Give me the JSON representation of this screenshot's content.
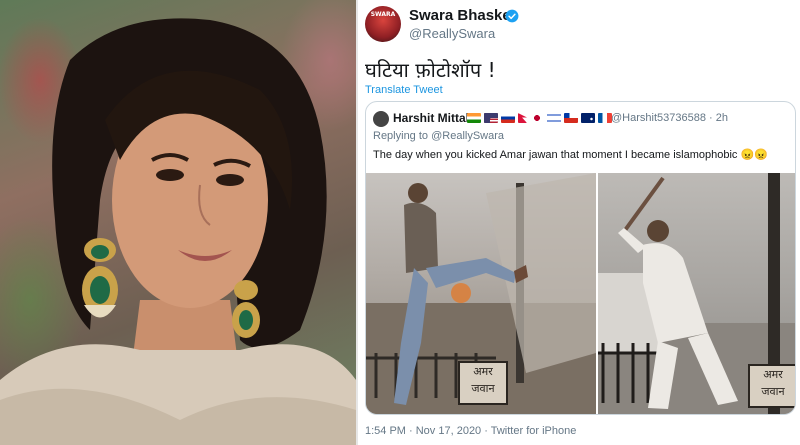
{
  "tweet": {
    "display_name": "Swara Bhasker",
    "handle": "@ReallySwara",
    "text": "घटिया फ़ोटोशॉप !",
    "translate_label": "Translate Tweet",
    "avatar_text": "SWARA",
    "meta": "1:54 PM · Nov 17, 2020 · Twitter for iPhone"
  },
  "quoted_tweet": {
    "display_name": "Harshit Mittal",
    "flags": [
      "india",
      "usa",
      "russia",
      "nepal",
      "japan",
      "israel",
      "chile",
      "australia",
      "france"
    ],
    "handle_time": "@Harshit53736588 · 2h",
    "replying_to_prefix": "Replying to ",
    "replying_to_handle": "@ReallySwara",
    "text": "The day when you kicked Amar jawan that moment I became islamophobic 😠😠",
    "plaque_left_line1": "अमर",
    "plaque_left_line2": "जवान",
    "plaque_right_line1": "अमर",
    "plaque_right_line2": "जवान"
  },
  "colors": {
    "link": "#1b95e0",
    "verified": "#1da1f2",
    "secondary_text": "#657786"
  }
}
